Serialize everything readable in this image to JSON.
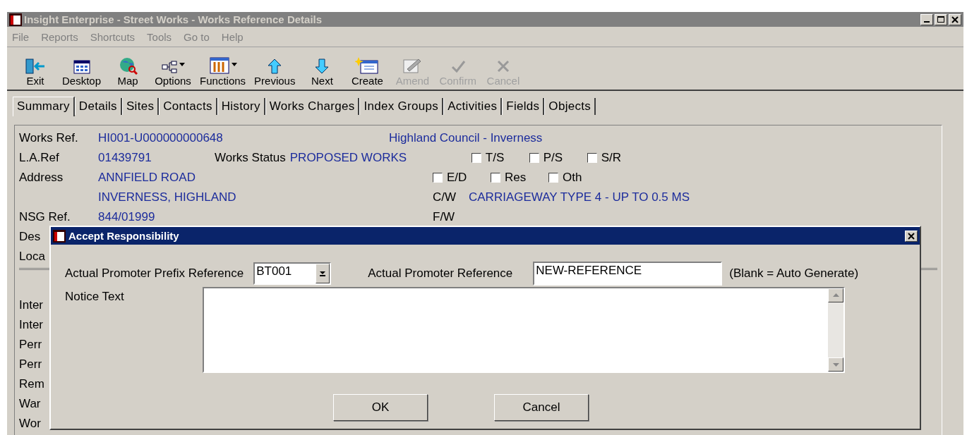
{
  "window": {
    "title": "Insight Enterprise - Street Works - Works Reference Details"
  },
  "menu": [
    "File",
    "Reports",
    "Shortcuts",
    "Tools",
    "Go to",
    "Help"
  ],
  "toolbar": [
    {
      "label": "Exit",
      "kind": "exit",
      "disabled": false,
      "dropdown": false
    },
    {
      "label": "Desktop",
      "kind": "desktop",
      "disabled": false,
      "dropdown": false
    },
    {
      "label": "Map",
      "kind": "map",
      "disabled": false,
      "dropdown": false
    },
    {
      "label": "Options",
      "kind": "options",
      "disabled": false,
      "dropdown": true
    },
    {
      "label": "Functions",
      "kind": "functions",
      "disabled": false,
      "dropdown": true
    },
    {
      "label": "Previous",
      "kind": "up",
      "disabled": false,
      "dropdown": false
    },
    {
      "label": "Next",
      "kind": "down",
      "disabled": false,
      "dropdown": false
    },
    {
      "label": "Create",
      "kind": "create",
      "disabled": false,
      "dropdown": false
    },
    {
      "label": "Amend",
      "kind": "amend",
      "disabled": true,
      "dropdown": false
    },
    {
      "label": "Confirm",
      "kind": "confirm",
      "disabled": true,
      "dropdown": false
    },
    {
      "label": "Cancel",
      "kind": "cancel",
      "disabled": true,
      "dropdown": false
    }
  ],
  "tabs": [
    {
      "label": "Summary",
      "selected": true
    },
    {
      "label": "Details",
      "selected": false
    },
    {
      "label": "Sites",
      "selected": false
    },
    {
      "label": "Contacts",
      "selected": false
    },
    {
      "label": "History",
      "selected": false
    },
    {
      "label": "Works Charges",
      "selected": false
    },
    {
      "label": "Index Groups",
      "selected": false
    },
    {
      "label": "Activities",
      "selected": false
    },
    {
      "label": "Fields",
      "selected": false
    },
    {
      "label": "Objects",
      "selected": false
    }
  ],
  "summary": {
    "works_ref_label": "Works Ref.",
    "works_ref": "HI001-U000000000648",
    "authority": "Highland Council - Inverness",
    "la_ref_label": "L.A.Ref",
    "la_ref": "01439791",
    "works_status_label": "Works Status",
    "works_status": "PROPOSED WORKS",
    "address_label": "Address",
    "address": [
      "ANNFIELD ROAD",
      "INVERNESS, HIGHLAND"
    ],
    "cw_label": "C/W",
    "cw": "CARRIAGEWAY TYPE 4 - UP TO 0.5 MS",
    "nsg_label": "NSG Ref.",
    "nsg": "844/01999",
    "fw_label": "F/W",
    "flags": [
      {
        "label": "T/S",
        "checked": false
      },
      {
        "label": "P/S",
        "checked": false
      },
      {
        "label": "S/R",
        "checked": false
      },
      {
        "label": "E/D",
        "checked": false
      },
      {
        "label": "Res",
        "checked": false
      },
      {
        "label": "Oth",
        "checked": false
      }
    ],
    "hidden_labels_top": [
      "Des",
      "Loca"
    ],
    "hidden_labels_bottom": [
      "Inter",
      "Inter",
      "Perr",
      "Perr",
      "Rem",
      "War",
      "Wor"
    ]
  },
  "dialog": {
    "title": "Accept Responsibility",
    "prefix_label": "Actual Promoter Prefix Reference",
    "prefix_value": "BT001",
    "reference_label": "Actual Promoter Reference",
    "reference_value": "NEW-REFERENCE",
    "reference_hint": "(Blank = Auto Generate)",
    "notice_label": "Notice Text",
    "buttons": [
      "OK",
      "Cancel"
    ]
  }
}
